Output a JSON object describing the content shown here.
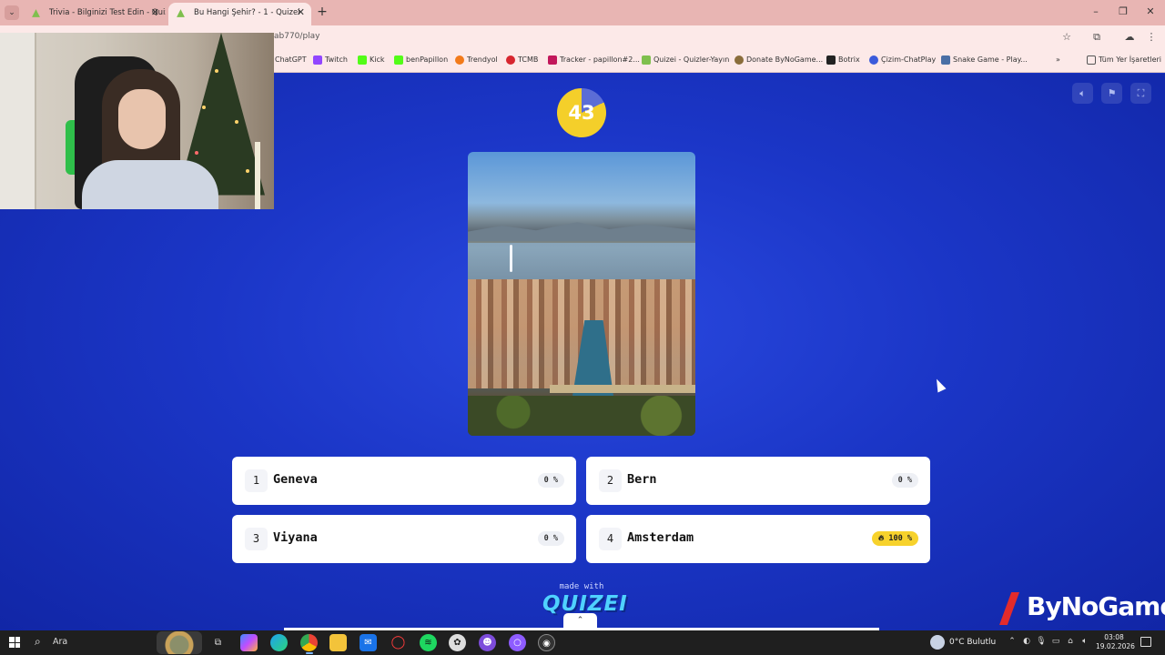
{
  "browser": {
    "tabs": [
      {
        "title": "Trivia - Bilginizi Test Edin - Quizei",
        "active": false
      },
      {
        "title": "Bu Hangi Şehir? - 1 - Quizei",
        "active": true
      }
    ],
    "url": "ab770/play",
    "bookmarks": [
      {
        "label": "ChatGPT",
        "color": "#10a37f"
      },
      {
        "label": "Twitch",
        "color": "#9146ff"
      },
      {
        "label": "Kick",
        "color": "#53fc18"
      },
      {
        "label": "benPapillon",
        "color": "#53fc18"
      },
      {
        "label": "Trendyol",
        "color": "#f27a1a"
      },
      {
        "label": "TCMB",
        "color": "#d7262f"
      },
      {
        "label": "Tracker - papillon#2...",
        "color": "#c2185b"
      },
      {
        "label": "Quizei - Quizler-Yayın",
        "color": "#7fbf4d"
      },
      {
        "label": "Donate ByNoGame...",
        "color": "#8a6d3b"
      },
      {
        "label": "Botrix",
        "color": "#222222"
      },
      {
        "label": "Çizim-ChatPlay",
        "color": "#3b5bdb"
      },
      {
        "label": "Snake Game - Play...",
        "color": "#4a6fa5"
      }
    ],
    "all_bookmarks_label": "Tüm Yer İşaretleri"
  },
  "quiz": {
    "timer_value": "43",
    "timer_remaining_fraction": 0.82,
    "answers": [
      {
        "number": "1",
        "label": "Geneva",
        "percent": "0 %",
        "leading": false
      },
      {
        "number": "2",
        "label": "Bern",
        "percent": "0 %",
        "leading": false
      },
      {
        "number": "3",
        "label": "Viyana",
        "percent": "0 %",
        "leading": false
      },
      {
        "number": "4",
        "label": "Amsterdam",
        "percent": "100 %",
        "leading": true
      }
    ],
    "made_with": "made with",
    "brand": "QUIZEI",
    "colors": {
      "background": "#1a34c4",
      "timer": "#f4cf2a",
      "lead_badge": "#f7d22c",
      "brand": "#4fd2ff"
    }
  },
  "overlay": {
    "sponsor": "ByNoGame"
  },
  "taskbar": {
    "search_label": "Ara",
    "weather": "0°C  Bulutlu",
    "time": "03:08",
    "date": "19.02.2026"
  }
}
